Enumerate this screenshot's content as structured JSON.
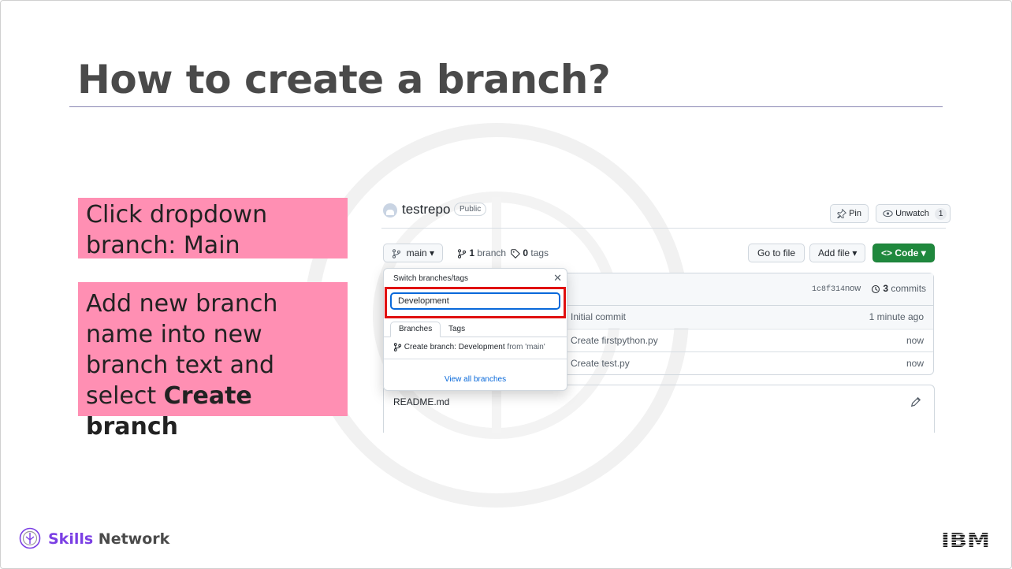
{
  "slide": {
    "title": "How to create a branch?"
  },
  "notes": {
    "note1": "Click dropdown branch: Main",
    "note2_prefix": "Add new branch name into new branch text and select ",
    "note2_bold": "Create branch"
  },
  "github": {
    "repo_name": "testrepo",
    "visibility": "Public",
    "pin_label": "Pin",
    "unwatch_label": "Unwatch",
    "watch_count": "1",
    "branch_label": "main",
    "branch_count": "1",
    "branch_word": "branch",
    "tag_count": "0",
    "tag_word": "tags",
    "goto_file_label": "Go to file",
    "add_file_label": "Add file",
    "code_label": "Code",
    "commit_sha": "1c8f314",
    "commit_time": "now",
    "commits_count": "3",
    "commits_word": "commits",
    "files": [
      {
        "message": "Initial commit",
        "when": "1 minute ago"
      },
      {
        "message": "Create firstpython.py",
        "when": "now"
      },
      {
        "message": "Create test.py",
        "when": "now"
      }
    ],
    "readme_title": "README.md"
  },
  "branch_popup": {
    "title": "Switch branches/tags",
    "input_value": "Development",
    "tabs": [
      "Branches",
      "Tags"
    ],
    "create_prefix": "Create branch: ",
    "create_name": "Development",
    "create_from": "from 'main'",
    "view_all": "View all branches"
  },
  "footer": {
    "brand_skills": "Skills",
    "brand_network": "Network",
    "ibm_logo_text": "IBM"
  },
  "colors": {
    "note_bg": "#ff8fb3",
    "code_btn": "#1f883d",
    "highlight": "#e01010",
    "brand_purple": "#7b3fe4"
  }
}
